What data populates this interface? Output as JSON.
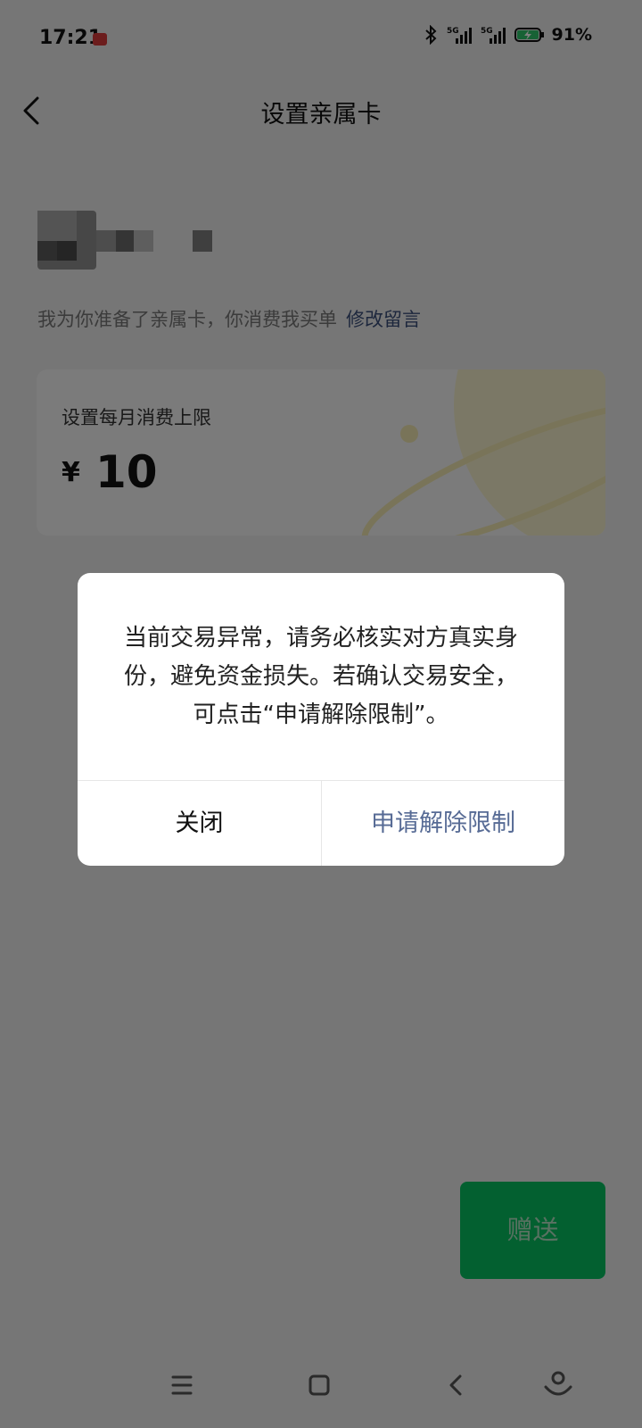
{
  "status_bar": {
    "time": "17:21",
    "battery_percent": "91%",
    "icons": [
      "bluetooth-icon",
      "signal-5g-icon",
      "signal-5g-icon",
      "battery-charging-icon"
    ]
  },
  "header": {
    "title": "设置亲属卡",
    "back_icon": "chevron-left-icon"
  },
  "recipient": {
    "message_text": "我为你准备了亲属卡，你消费我买单",
    "edit_link": "修改留言"
  },
  "limit_card": {
    "label": "设置每月消费上限",
    "currency": "¥",
    "amount": "10"
  },
  "send_button": "赠送",
  "dialog": {
    "message": "当前交易异常，请务必核实对方真实身份，避免资金损失。若确认交易安全，可点击“申请解除限制”。",
    "close_label": "关闭",
    "apply_label": "申请解除限制"
  },
  "nav_bar": {
    "icons": [
      "menu-icon",
      "home-square-icon",
      "back-icon",
      "assistant-icon"
    ]
  },
  "colors": {
    "wechat_green": "#07c160",
    "link_blue": "#576b95",
    "background": "#ededed"
  }
}
